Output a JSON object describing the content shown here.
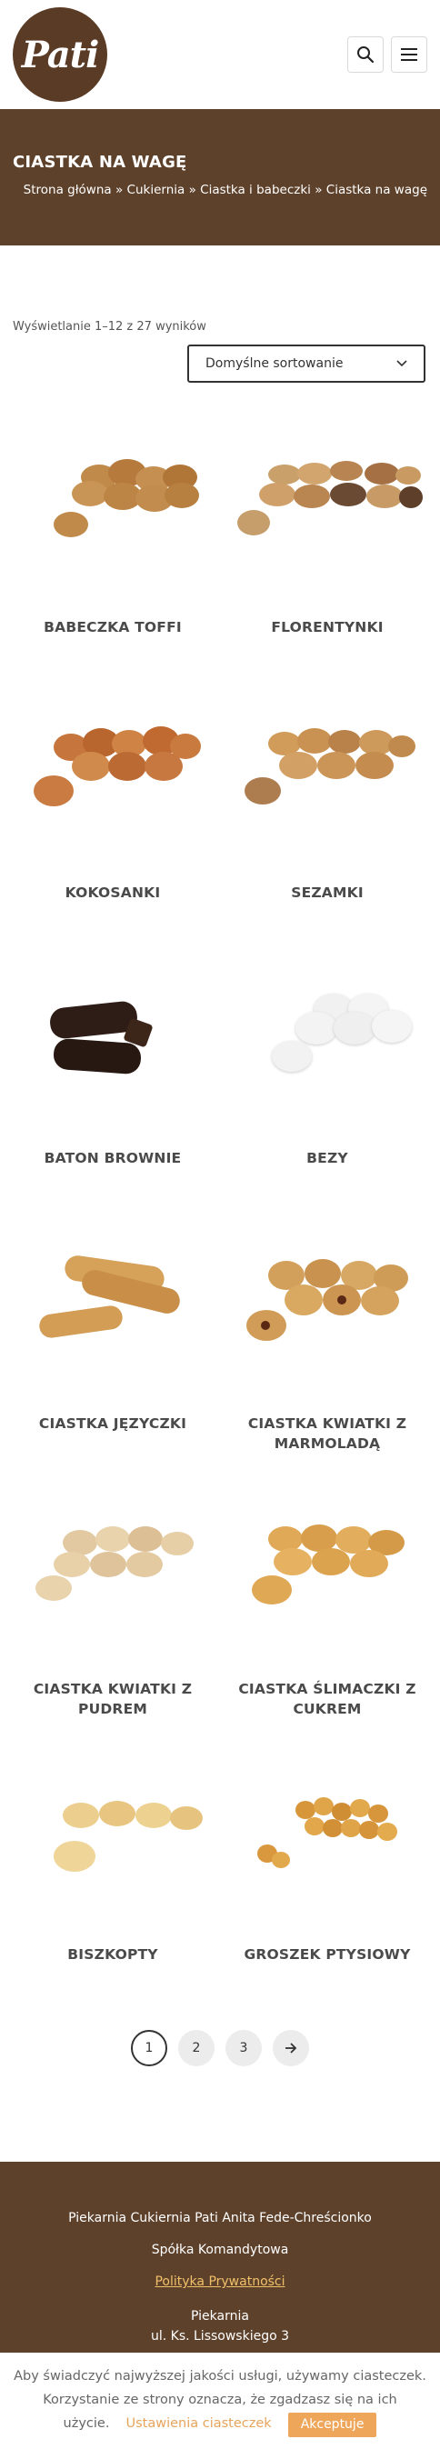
{
  "header": {
    "logo_text": "Pati",
    "search_icon": "search-icon",
    "menu_icon": "hamburger-menu-icon"
  },
  "title_band": {
    "title": "CIASTKA NA WAGĘ",
    "breadcrumb": [
      "Strona główna",
      "Cukiernia",
      "Ciastka i babeczki",
      "Ciastka na wagę"
    ],
    "separator": "»"
  },
  "results": {
    "count_text": "Wyświetlanie 1–12 z 27 wyników",
    "sort_selected": "Domyślne sortowanie"
  },
  "products": [
    {
      "name": "BABECZKA TOFFI"
    },
    {
      "name": "FLORENTYNKI"
    },
    {
      "name": "KOKOSANKI"
    },
    {
      "name": "SEZAMKI"
    },
    {
      "name": "BATON BROWNIE"
    },
    {
      "name": "BEZY"
    },
    {
      "name": "CIASTKA JĘZYCZKI"
    },
    {
      "name": "CIASTKA KWIATKI Z MARMOLADĄ"
    },
    {
      "name": "CIASTKA KWIATKI Z PUDREM"
    },
    {
      "name": "CIASTKA ŚLIMACZKI Z CUKREM"
    },
    {
      "name": "BISZKOPTY"
    },
    {
      "name": "GROSZEK PTYSIOWY"
    }
  ],
  "pagination": {
    "pages": [
      "1",
      "2",
      "3"
    ],
    "current": "1",
    "next_icon": "arrow-right-icon"
  },
  "footer": {
    "company": "Piekarnia Cukiernia Pati Anita Fede-Chreścionko",
    "company_type": "Spółka Komandytowa",
    "privacy_link": "Polityka Prywatności",
    "bakery_label": "Piekarnia",
    "bakery_address": "ul. Ks. Lissowskiego 3"
  },
  "cookie_bar": {
    "line1": "Aby świadczyć najwyższej jakości usługi, używamy ciasteczek.",
    "line2": "Korzystanie ze strony oznacza, że zgadzasz się na ich",
    "line3": "użycie.",
    "settings_link": "Ustawienia ciasteczek",
    "accept_label": "Akceptuje"
  },
  "colors": {
    "brand_brown": "#5e412b",
    "accent_orange": "#eea65a",
    "link_yellow": "#f0c069"
  }
}
